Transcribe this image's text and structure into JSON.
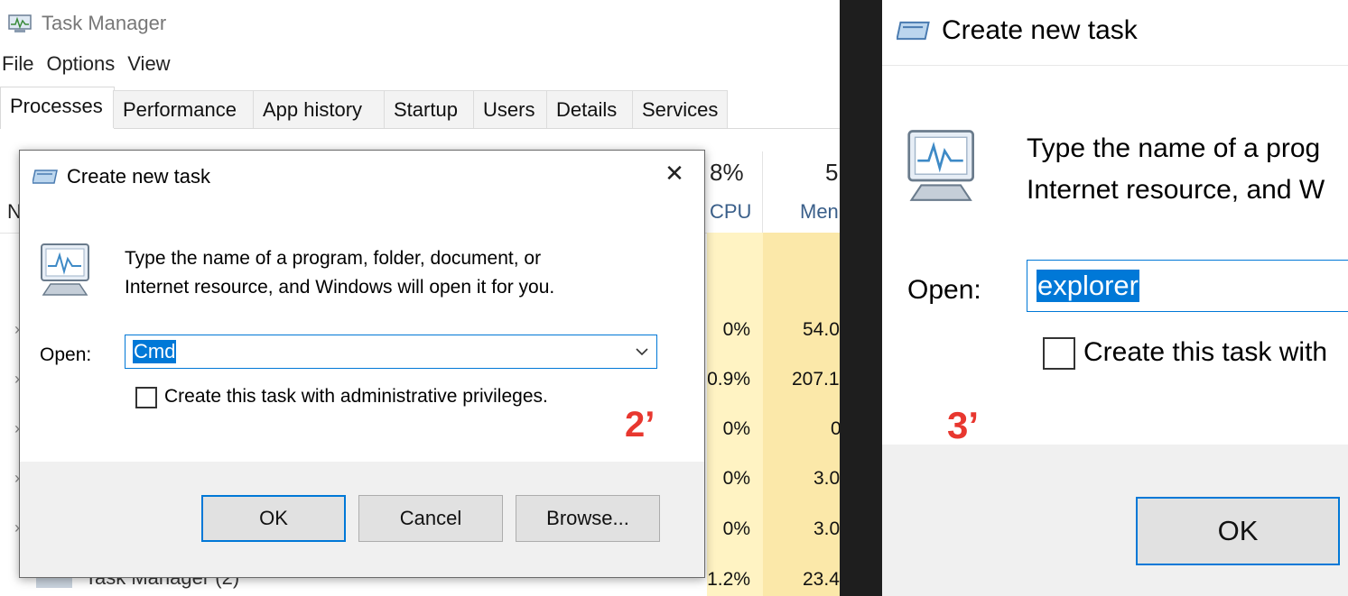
{
  "task_manager": {
    "title": "Task Manager",
    "menu": [
      "File",
      "Options",
      "View"
    ],
    "tabs": [
      "Processes",
      "Performance",
      "App history",
      "Startup",
      "Users",
      "Details",
      "Services"
    ],
    "active_tab": "Processes",
    "columns": {
      "name_partial": "N",
      "cpu_percent": "8%",
      "cpu_label": "CPU",
      "mem_percent": "5",
      "mem_label": "Men"
    },
    "rows": [
      {
        "cpu": "0%",
        "mem": "54.0"
      },
      {
        "cpu": "0.9%",
        "mem": "207.1"
      },
      {
        "cpu": "0%",
        "mem": "0"
      },
      {
        "cpu": "0%",
        "mem": "3.0"
      },
      {
        "cpu": "0%",
        "mem": "3.0"
      },
      {
        "cpu": "1.2%",
        "mem": "23.4"
      }
    ],
    "last_row_name": "Task Manager (2)"
  },
  "dialog_left": {
    "title": "Create new task",
    "close_glyph": "✕",
    "line1": "Type the name of a program, folder, document, or",
    "line2": "Internet resource, and Windows will open it for you.",
    "open_label": "Open:",
    "open_value": "Cmd",
    "admin_label": "Create this task with administrative privileges.",
    "admin_checked": false,
    "ok": "OK",
    "cancel": "Cancel",
    "browse": "Browse...",
    "annotation": "2’"
  },
  "dialog_right": {
    "title": "Create new task",
    "line1": "Type the name of a prog",
    "line2": "Internet resource, and W",
    "open_label": "Open:",
    "open_value": "explorer",
    "admin_label": "Create this task with",
    "admin_checked": false,
    "ok": "OK",
    "annotation": "3’"
  },
  "colors": {
    "accent": "#0078d7",
    "annotation": "#e8372f",
    "cpu_highlight": "#fff3c3",
    "mem_highlight": "#fbe8a9",
    "separator": "#1e1e1e"
  },
  "icons": [
    "task-manager-icon",
    "run-dialog-icon",
    "monitor-chart-icon",
    "close-icon",
    "chevron-down-icon",
    "expand-arrow-icon"
  ]
}
